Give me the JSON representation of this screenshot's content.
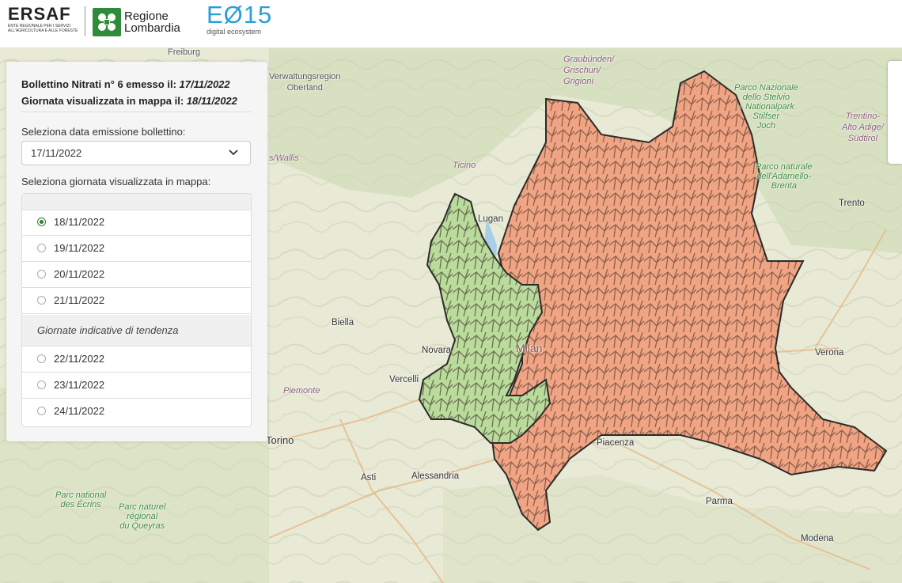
{
  "header": {
    "ersaf": {
      "word": "ERSAF",
      "subtitle": "ENTE REGIONALE PER I SERVIZI ALL'AGRICOLTURA E ALLE FORESTE"
    },
    "lombardia": {
      "line1": "Regione",
      "line2": "Lombardia"
    },
    "e015": {
      "word": "EØ15",
      "subtitle": "digital ecosystem"
    }
  },
  "panel": {
    "bulletin_prefix": "Bollettino Nitrati n° 6 emesso il:",
    "bulletin_date": "17/11/2022",
    "map_day_prefix": "Giornata visualizzata in mappa il:",
    "map_day_date": "18/11/2022",
    "select_label": "Seleziona data emissione bollettino:",
    "select_value": "17/11/2022",
    "radio_label": "Seleziona giornata visualizzata in mappa:",
    "days": [
      "18/11/2022",
      "19/11/2022",
      "20/11/2022",
      "21/11/2022"
    ],
    "selected_day": "18/11/2022",
    "trend_header": "Giornate indicative di tendenza",
    "trend_days": [
      "22/11/2022",
      "23/11/2022",
      "24/11/2022"
    ]
  },
  "map": {
    "labels": {
      "freiburg": "Freiburg",
      "graubunden": "Graubünden/\nGrischun/\nGrigioni",
      "verwaltung": "Verwaltungsregion\nOberland",
      "stelvio": "Parco Nazionale\ndello Stelvio\n– Nationalpark\nStilfser\nJoch",
      "trentino": "Trentino-\nAlto Adige/\nSüdtirol",
      "adamello": "Parco naturale\ndell'Adamello-\nBrenta",
      "wallis": "s/Wallis",
      "ticino": "Ticino",
      "lugano": "Lugan",
      "trento": "Trento",
      "biella": "Biella",
      "novara": "Novara",
      "milano": "Milan",
      "verona": "Verona",
      "vercelli": "Vercelli",
      "piemonte": "Piemonte",
      "torino": "Torino",
      "piacenza": "Piacenza",
      "asti": "Asti",
      "alessandria": "Alessandria",
      "parma": "Parma",
      "modena": "Modena",
      "ecrins": "Parc national\ndes Écrins",
      "queyras": "Parc naturel\nrégional\ndu Queyras"
    },
    "colors": {
      "green_zone": "#b9db9c",
      "orange_zone": "#f0a483",
      "border": "#2b2b2b",
      "water": "#a8cfe8"
    }
  }
}
